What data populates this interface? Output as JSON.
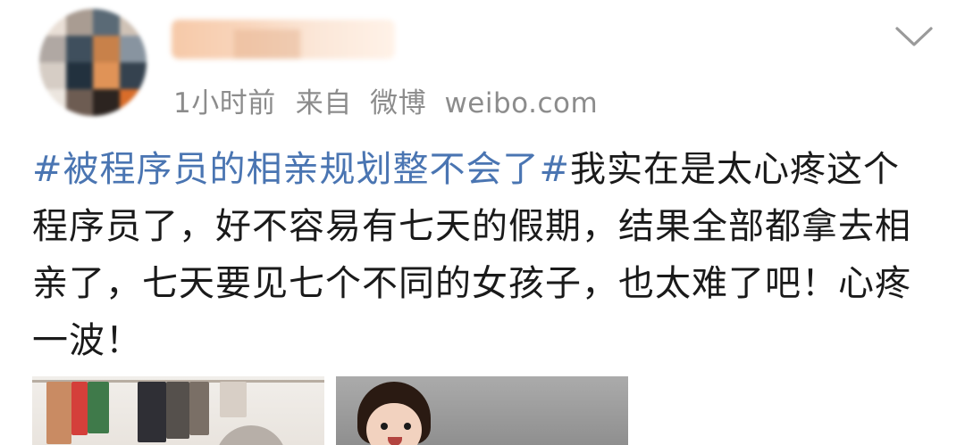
{
  "post": {
    "author": {
      "avatar": "pixelated-avatar",
      "name_obscured": true
    },
    "time": "1小时前",
    "source_prefix": "来自",
    "source_app": "微博",
    "source_domain": "weibo.com",
    "hashtag": "#被程序员的相亲规划整不会了#",
    "body": "我实在是太心疼这个程序员了，好不容易有七天的假期，结果全部都拿去相亲了，七天要见七个不同的女孩子，也太难了吧！心疼一波！",
    "menu_icon": "chevron-down-icon"
  },
  "colors": {
    "hashtag": "#4a75b2",
    "meta_text": "#8c8c8c",
    "body_text": "#1a1a1a",
    "background": "#ffffff"
  },
  "images": [
    {
      "name": "post-image-1",
      "description_icon": "photo"
    },
    {
      "name": "post-image-2",
      "description_icon": "photo"
    }
  ]
}
